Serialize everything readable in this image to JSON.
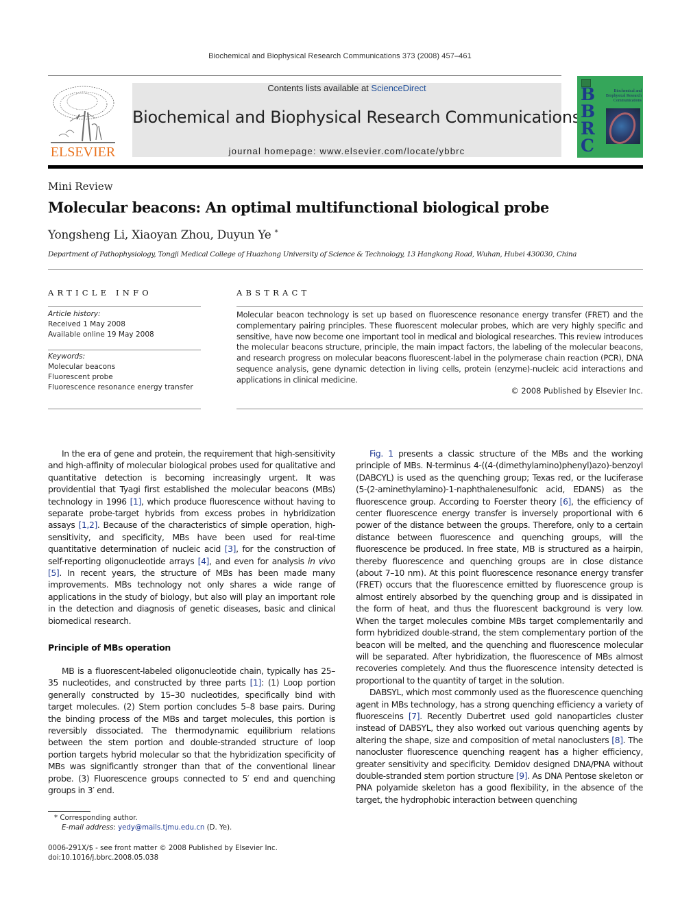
{
  "running_head": "Biochemical and Biophysical Research Communications 373 (2008) 457–461",
  "header": {
    "publisher_logo_text": "ELSEVIER",
    "contents_prefix": "Contents lists available at ",
    "contents_link": "ScienceDirect",
    "journal_title": "Biochemical and Biophysical Research Communications",
    "homepage": "journal homepage: www.elsevier.com/locate/ybbrc",
    "cover": {
      "acronym_letters": [
        "B",
        "B",
        "R",
        "C"
      ],
      "title": "Biochemical and Biophysical Research Communications",
      "colors": {
        "background": "#35a65a",
        "acronym": "#1d3a8a"
      }
    },
    "colors": {
      "elsevier_orange": "#e9711c",
      "link_blue": "#1f4e99",
      "banner_gray": "#e6e6e6"
    }
  },
  "article": {
    "type": "Mini Review",
    "title": "Molecular beacons: An optimal multifunctional biological probe",
    "authors": "Yongsheng Li, Xiaoyan Zhou, Duyun Ye",
    "corresponding_marker": "*",
    "affiliation": "Department of Pathophysiology, Tongji Medical College of Huazhong University of Science & Technology, 13 Hangkong Road, Wuhan, Hubei 430030, China"
  },
  "article_info": {
    "heading": "ARTICLE INFO",
    "history_label": "Article history:",
    "received": "Received 1 May 2008",
    "available_online": "Available online 19 May 2008",
    "keywords_label": "Keywords:",
    "keywords": [
      "Molecular beacons",
      "Fluorescent probe",
      "Fluorescence resonance energy transfer"
    ]
  },
  "abstract": {
    "heading": "ABSTRACT",
    "text": "Molecular beacon technology is set up based on fluorescence resonance energy transfer (FRET) and the complementary pairing principles. These fluorescent molecular probes, which are very highly specific and sensitive, have now become one important tool in medical and biological researches. This review introduces the molecular beacons structure, principle, the main impact factors, the labeling of the molecular beacons, and research progress on molecular beacons fluorescent-label in the polymerase chain reaction (PCR), DNA sequence analysis, gene dynamic detection in living cells, protein (enzyme)-nucleic acid interactions and applications in clinical medicine.",
    "copyright": "© 2008 Published by Elsevier Inc."
  },
  "body": {
    "left": {
      "intro": [
        {
          "t": "In the era of gene and protein, the requirement that high-sensitivity and high-affinity of molecular biological probes used for qualitative and quantitative detection is becoming increasingly urgent. It was providential that Tyagi first established the molecular beacons (MBs) technology in 1996 "
        },
        {
          "r": "[1]"
        },
        {
          "t": ", which produce fluorescence without having to separate probe-target hybrids from excess probes in hybridization assays "
        },
        {
          "r": "[1,2]"
        },
        {
          "t": ". Because of the characteristics of simple operation, high-sensitivity, and specificity, MBs have been used for real-time quantitative determination of nucleic acid "
        },
        {
          "r": "[3]"
        },
        {
          "t": ", for the construction of self-reporting oligonucleotide arrays "
        },
        {
          "r": "[4]"
        },
        {
          "t": ", and even for analysis "
        },
        {
          "i": "in vivo"
        },
        {
          "t": " "
        },
        {
          "r": "[5]"
        },
        {
          "t": ". In recent years, the structure of MBs has been made many improvements. MBs technology not only shares a wide range of applications in the study of biology, but also will play an important role in the detection and diagnosis of genetic diseases, basic and clinical biomedical research."
        }
      ],
      "section_heading": "Principle of MBs operation",
      "principle": [
        {
          "t": "MB is a fluorescent-labeled oligonucleotide chain, typically has 25–35 nucleotides, and constructed by three parts "
        },
        {
          "r": "[1]"
        },
        {
          "t": ": (1) Loop portion generally constructed by 15–30 nucleotides, specifically bind with target molecules. (2) Stem portion concludes 5–8 base pairs. During the binding process of the MBs and target molecules, this portion is reversibly dissociated. The thermodynamic equilibrium relations between the stem portion and double-stranded structure of loop portion targets hybrid molecular so that the hybridization specificity of MBs was significantly stronger than that of the conventional linear probe. (3) Fluorescence groups connected to 5′ end and quenching groups in 3′ end."
        }
      ]
    },
    "right": {
      "para1": [
        {
          "r": "Fig. 1"
        },
        {
          "t": " presents a classic structure of the MBs and the working principle of MBs. N-terminus 4-((4-(dimethylamino)phenyl)azo)-benzoyl (DABCYL) is used as the quenching group; Texas red, or the luciferase (5-(2-aminethylamino)-1-naphthalenesulfonic acid, EDANS) as the fluorescence group. According to Foerster theory "
        },
        {
          "r": "[6]"
        },
        {
          "t": ", the efficiency of center fluorescence energy transfer is inversely proportional with 6 power of the distance between the groups. Therefore, only to a certain distance between fluorescence and quenching groups, will the fluorescence be produced. In free state, MB is structured as a hairpin, thereby fluorescence and quenching groups are in close distance (about 7–10 nm). At this point fluorescence resonance energy transfer (FRET) occurs that the fluorescence emitted by fluorescence group is almost entirely absorbed by the quenching group and is dissipated in the form of heat, and thus the fluorescent background is very low. When the target molecules combine MBs target complementarily and form hybridized double-strand, the stem complementary portion of the beacon will be melted, and the quenching and fluorescence molecular will be separated. After hybridization, the fluorescence of MBs almost recoveries completely. And thus the fluorescence intensity detected is proportional to the quantity of target in the solution."
        }
      ],
      "para2": [
        {
          "t": "DABSYL, which most commonly used as the fluorescence quenching agent in MBs technology, has a strong quenching efficiency a variety of fluoresceins "
        },
        {
          "r": "[7]"
        },
        {
          "t": ". Recently Dubertret used gold nanoparticles cluster instead of DABSYL, they also worked out various quenching agents by altering the shape, size and composition of metal nanoclusters "
        },
        {
          "r": "[8]"
        },
        {
          "t": ". The nanocluster fluorescence quenching reagent has a higher efficiency, greater sensitivity and specificity. Demidov designed DNA/PNA without double-stranded stem portion structure "
        },
        {
          "r": "[9]"
        },
        {
          "t": ". As DNA Pentose skeleton or PNA polyamide skeleton has a good flexibility, in the absence of the target, the hydrophobic interaction between quenching"
        }
      ]
    }
  },
  "footnotes": {
    "marker": "*",
    "corresponding": "Corresponding author.",
    "email_label": "E-mail address:",
    "email": "yedy@mails.tjmu.edu.cn",
    "email_suffix": " (D. Ye).",
    "issn_line": "0006-291X/$ - see front matter © 2008 Published by Elsevier Inc.",
    "doi": "doi:10.1016/j.bbrc.2008.05.038"
  }
}
